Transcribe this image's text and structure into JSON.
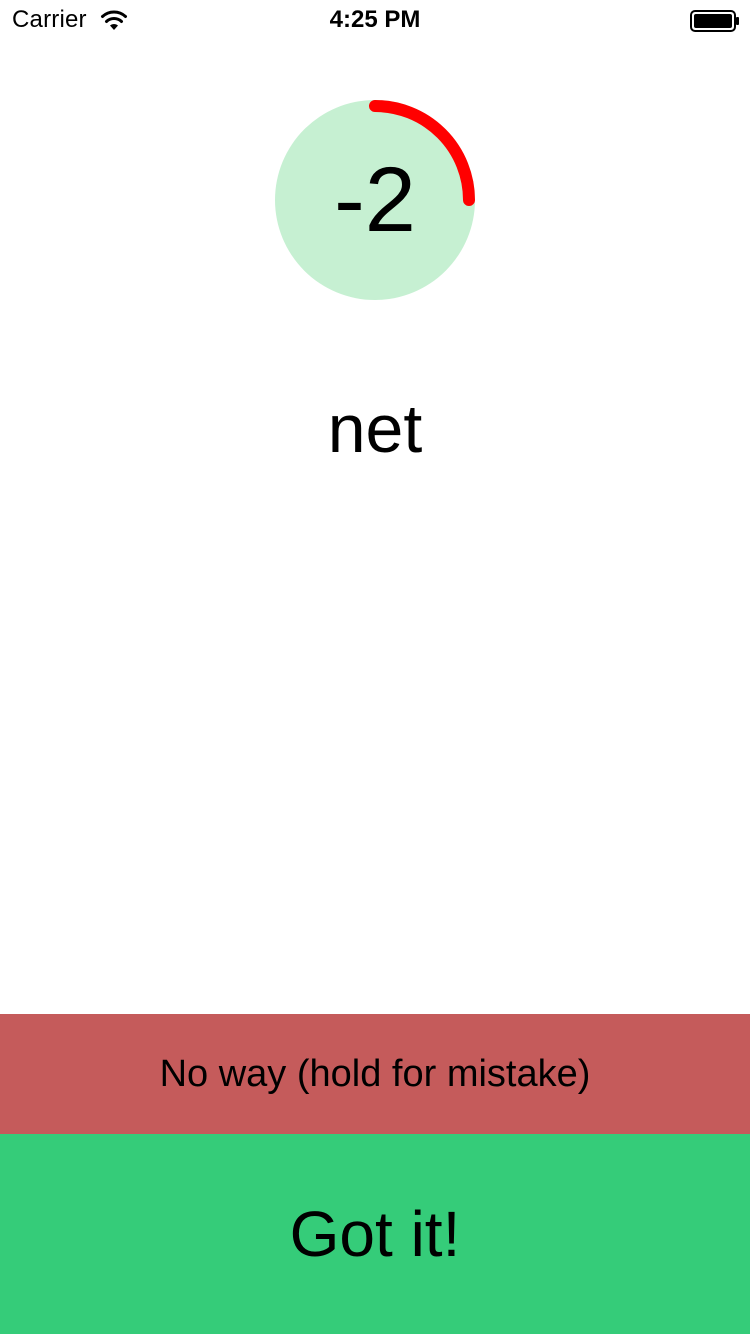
{
  "status_bar": {
    "carrier": "Carrier",
    "time": "4:25 PM",
    "wifi_icon": "wifi-icon",
    "battery_icon": "battery-icon"
  },
  "timer": {
    "value": "-2",
    "circle_color": "#c6f0d2",
    "arc_color": "#ff0000",
    "arc_fraction": 0.25
  },
  "word": "net",
  "buttons": {
    "mistake": {
      "label": "No way (hold for mistake)",
      "color": "#c55b5b"
    },
    "got_it": {
      "label": "Got it!",
      "color": "#35cc79"
    }
  }
}
